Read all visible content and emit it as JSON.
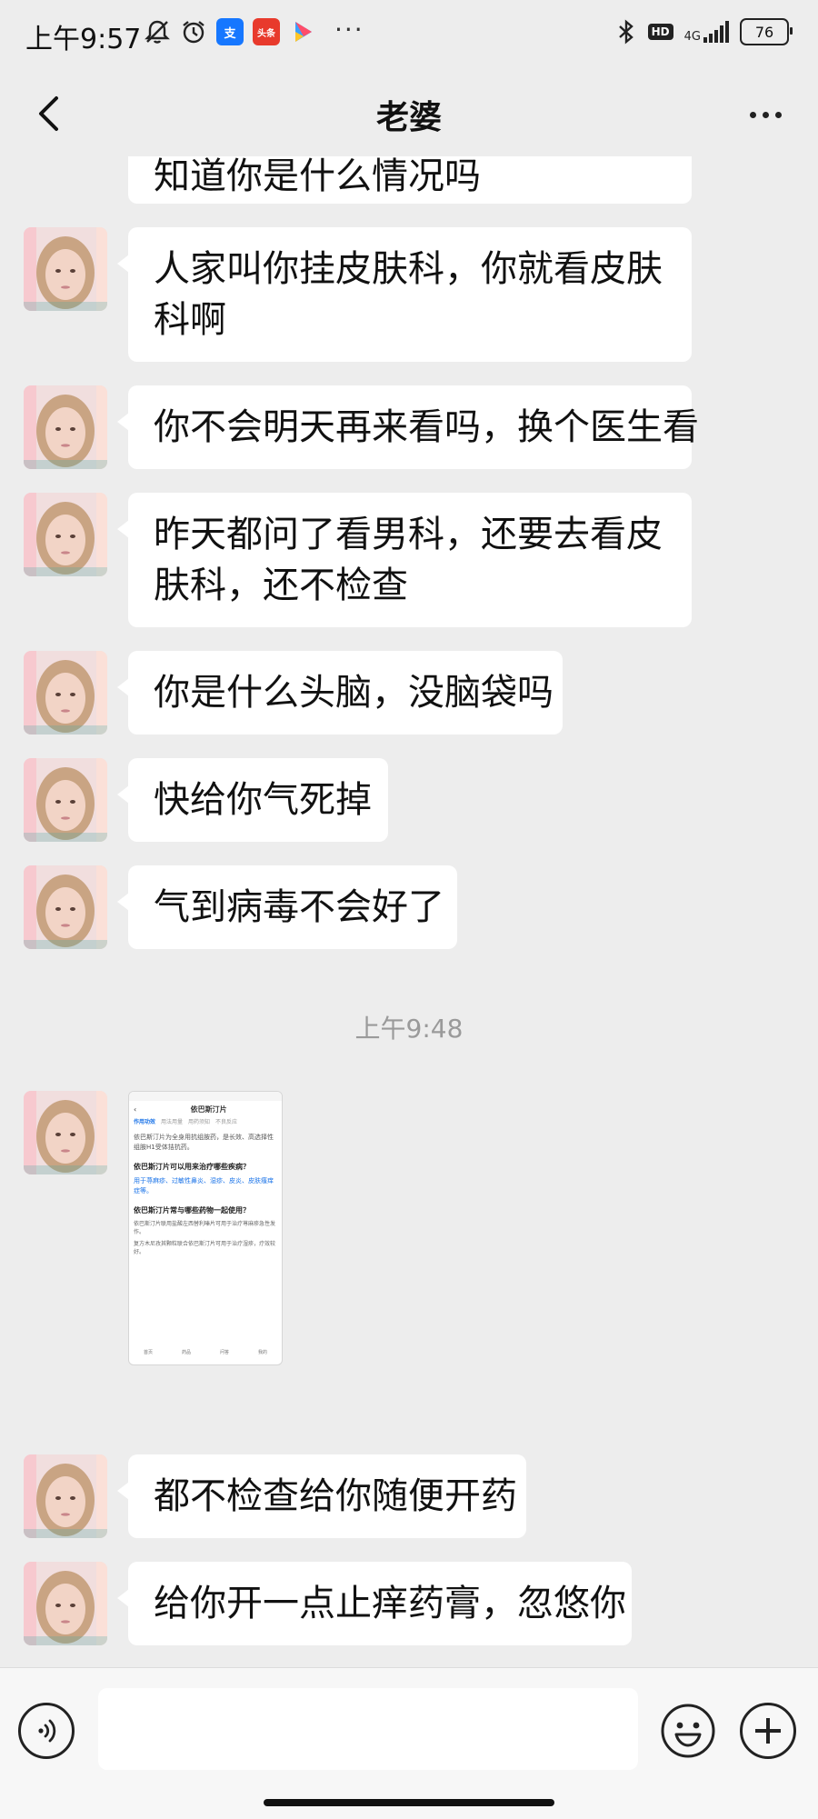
{
  "status_bar": {
    "time": "上午9:57",
    "app_icons": [
      {
        "name": "alipay",
        "label": "支",
        "color": "#1677ff"
      },
      {
        "name": "toutiao",
        "label": "头条",
        "color": "#e83a2c"
      }
    ],
    "more": "···",
    "network": "4G",
    "hd_label": "HD",
    "battery": "76"
  },
  "nav": {
    "title": "老婆"
  },
  "chat": {
    "messages": [
      {
        "text": "知道你是什么情况吗"
      },
      {
        "text": "人家叫你挂皮肤科，你就看皮肤科啊"
      },
      {
        "text": "你不会明天再来看吗，换个医生看"
      },
      {
        "text": "昨天都问了看男科，还要去看皮肤科，还不检查"
      },
      {
        "text": "你是什么头脑，没脑袋吗"
      },
      {
        "text": "快给你气死掉"
      },
      {
        "text": "气到病毒不会好了"
      },
      {
        "text": "都不检查给你随便开药"
      },
      {
        "text": "给你开一点止痒药膏，忽悠你"
      }
    ],
    "timestamp": "上午9:48",
    "image_message": {
      "title": "依巴斯汀片",
      "tabs": [
        "作用功效",
        "用法用量",
        "用药须知",
        "不良反应"
      ],
      "intro": "依巴斯汀片为全身用抗组胺药，是长效、高选择性组胺H1受体拮抗药。",
      "q1": "依巴斯汀片可以用来治疗哪些疾病？",
      "a1": "用于荨麻疹、过敏性鼻炎、湿疹、皮炎、皮肤瘙痒症等。",
      "q2": "依巴斯汀片常与哪些药物一起使用？",
      "bullets": [
        "依巴斯汀片联用盐酸左西替利嗪片可用于治疗荨麻疹急性发作。",
        "复方木尼孜其颗粒联合依巴斯汀片可用于治疗湿疹，疗效较好。"
      ],
      "bottom_tabs": [
        "首页",
        "药品",
        "问答",
        "我的"
      ]
    }
  },
  "input": {
    "placeholder": ""
  }
}
